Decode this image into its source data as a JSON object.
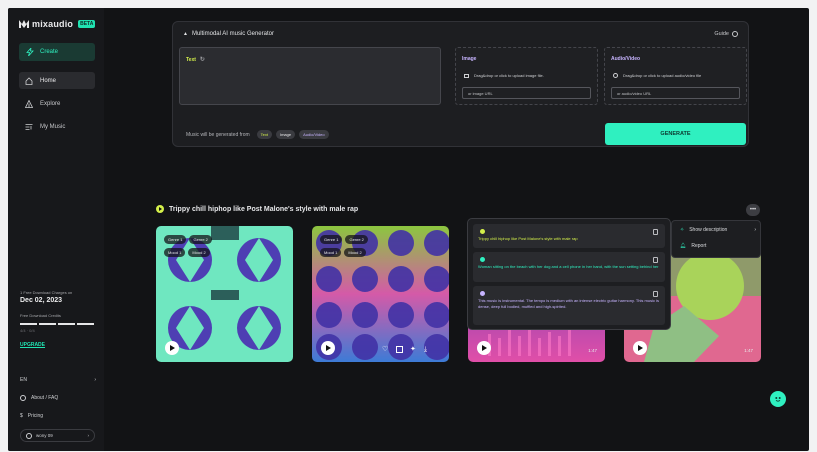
{
  "brand": {
    "name": "mixaudio",
    "badge": "BETA"
  },
  "sidebar": {
    "create_label": "Create",
    "items": [
      {
        "label": "Home",
        "icon": "home-icon"
      },
      {
        "label": "Explore",
        "icon": "explore-icon"
      },
      {
        "label": "My Music",
        "icon": "music-library-icon"
      }
    ],
    "download_note": "1 Free Download Charges on",
    "download_date": "Dec 02, 2023",
    "credits_label": "Free Download Credits",
    "credits_count": "4/4 · 0/4",
    "upgrade_label": "UPGRADE",
    "language": "EN",
    "about_label": "About / FAQ",
    "pricing_label": "Pricing",
    "user_name": "wony 09"
  },
  "generator": {
    "title": "Multimodal AI music Generator",
    "guide_label": "Guide",
    "text_label": "Text",
    "image_label": "Image",
    "image_hint": "Drag&drop or click to upload image file.",
    "image_url_placeholder": "or image URL",
    "av_label": "Audio/Video",
    "av_hint": "Drag&drop or click to upload audio/video file",
    "av_url_placeholder": "or audio/video URL",
    "from_label": "Music will be generated from",
    "chips": [
      "Text",
      "Image",
      "Audio/Video"
    ],
    "generate_label": "GENERATE"
  },
  "result": {
    "prompt": "Trippy chill hiphop like Post Malone's style with male rap",
    "cards": [
      {
        "tags": [
          "Genre 1",
          "Genre 2",
          "Mood 1",
          "Mood 2"
        ],
        "duration": "1:47"
      },
      {
        "tags": [
          "Genre 1",
          "Genre 2",
          "Mood 1",
          "Mood 2"
        ],
        "duration": "1:47"
      },
      {
        "tags": [],
        "duration": "1:47"
      },
      {
        "tags": [],
        "duration": "1:47"
      }
    ],
    "descriptions": [
      {
        "text": "Trippy chill hiphop like Post Malone's style with male rap",
        "color": "#d4f04a"
      },
      {
        "text": "Woman sitting on the beach with her dog and a cell phone in her hand, with the sun setting behind her",
        "color": "#2ff0c0"
      },
      {
        "text": "This music is instrumental. The tempo is medium with an intense electric guitar harmony. This music is dense, deep full bodied, muffled and high-spirited.",
        "color": "#c7b4ff"
      }
    ],
    "menu": {
      "show_description": "Show description",
      "report": "Report"
    }
  },
  "colors": {
    "accent": "#2ff0c0",
    "text_chip": "#d4f04a",
    "av_chip": "#c7b4ff",
    "background": "#121315"
  }
}
